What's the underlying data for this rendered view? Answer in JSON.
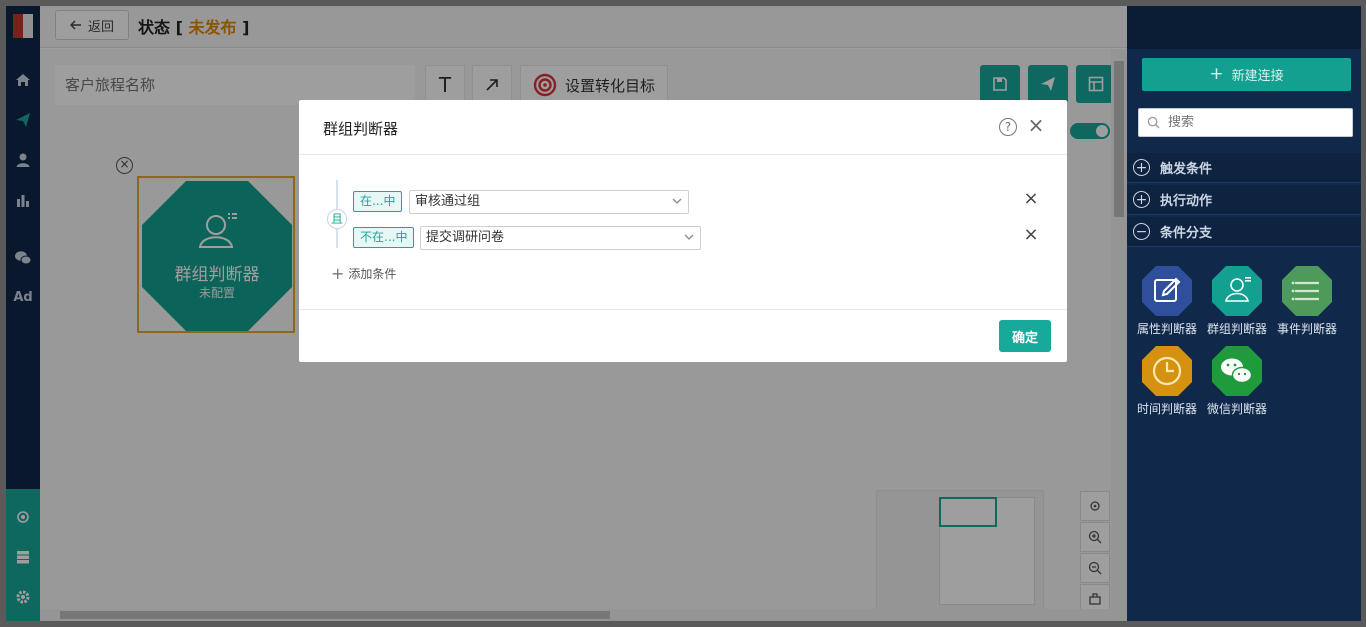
{
  "header": {
    "back_label": "返回",
    "title": "状态",
    "bracket_open": "[",
    "status": "未发布",
    "bracket_close": "]"
  },
  "leftnav": {
    "ad_label": "Ad"
  },
  "toolbar": {
    "name_placeholder": "客户旅程名称",
    "text_tool": "T",
    "goal_label": "设置转化目标"
  },
  "node": {
    "title": "群组判断器",
    "subtitle": "未配置"
  },
  "right_panel": {
    "new_connection_label": "新建连接",
    "search_placeholder": "搜索",
    "sections": [
      {
        "label": "触发条件",
        "symbol": "+"
      },
      {
        "label": "执行动作",
        "symbol": "+"
      },
      {
        "label": "条件分支",
        "symbol": "−"
      }
    ],
    "tools": [
      {
        "label": "属性判断器",
        "color": "#2f4f9d"
      },
      {
        "label": "群组判断器",
        "color": "#14a090"
      },
      {
        "label": "事件判断器",
        "color": "#4e9a5a"
      },
      {
        "label": "时间判断器",
        "color": "#d4920f"
      },
      {
        "label": "微信判断器",
        "color": "#1f9a3c"
      }
    ]
  },
  "modal": {
    "title": "群组判断器",
    "help_symbol": "?",
    "close_symbol": "×",
    "logic": "且",
    "conditions": [
      {
        "op": "在...中",
        "value": "审核通过组"
      },
      {
        "op": "不在...中",
        "value": "提交调研问卷"
      }
    ],
    "delete_symbol": "×",
    "add_label": "添加条件",
    "add_symbol": "+",
    "ok_label": "确定"
  },
  "colors": {
    "accent": "#17a99a",
    "nav_bg": "#0f2748",
    "status_orange": "#e08a00"
  }
}
